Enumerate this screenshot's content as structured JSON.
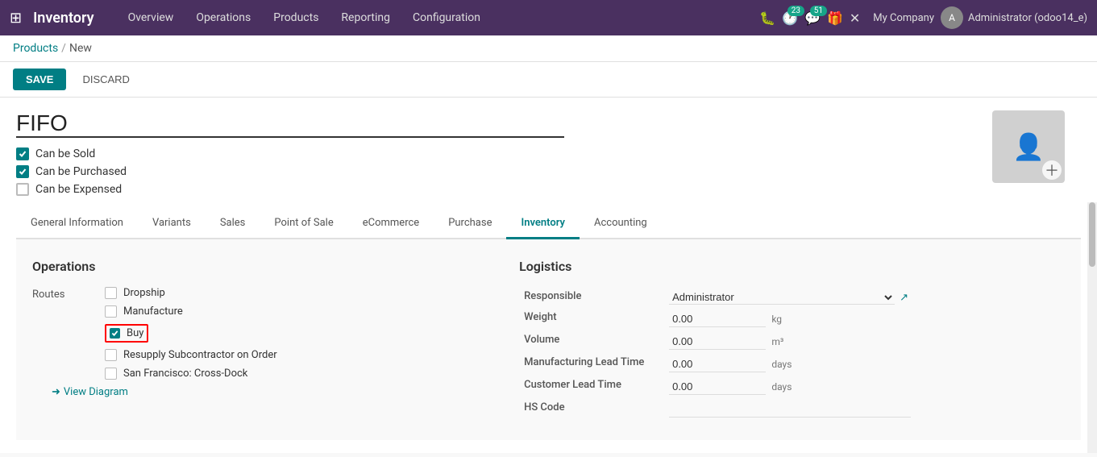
{
  "topbar": {
    "app_name": "Inventory",
    "nav_items": [
      "Overview",
      "Operations",
      "Products",
      "Reporting",
      "Configuration"
    ],
    "badge_23": "23",
    "badge_51": "51",
    "company": "My Company",
    "user": "Administrator (odoo14_e)"
  },
  "breadcrumb": {
    "link": "Products",
    "separator": "/",
    "current": "New"
  },
  "actions": {
    "save": "SAVE",
    "discard": "DISCARD"
  },
  "product": {
    "name": "FIFO",
    "can_be_sold": true,
    "can_be_purchased": true,
    "can_be_expensed": false
  },
  "tabs": [
    {
      "label": "General Information",
      "active": false
    },
    {
      "label": "Variants",
      "active": false
    },
    {
      "label": "Sales",
      "active": false
    },
    {
      "label": "Point of Sale",
      "active": false
    },
    {
      "label": "eCommerce",
      "active": false
    },
    {
      "label": "Purchase",
      "active": false
    },
    {
      "label": "Inventory",
      "active": true
    },
    {
      "label": "Accounting",
      "active": false
    }
  ],
  "operations": {
    "section_title": "Operations",
    "routes_label": "Routes",
    "routes": [
      {
        "label": "Dropship",
        "checked": false,
        "highlighted": false
      },
      {
        "label": "Manufacture",
        "checked": false,
        "highlighted": false
      },
      {
        "label": "Buy",
        "checked": true,
        "highlighted": true
      },
      {
        "label": "Resupply Subcontractor on Order",
        "checked": false,
        "highlighted": false
      },
      {
        "label": "San Francisco: Cross-Dock",
        "checked": false,
        "highlighted": false
      }
    ],
    "view_diagram": "View Diagram"
  },
  "logistics": {
    "section_title": "Logistics",
    "responsible_label": "Responsible",
    "responsible_value": "Administrator",
    "weight_label": "Weight",
    "weight_value": "0.00",
    "weight_unit": "kg",
    "volume_label": "Volume",
    "volume_value": "0.00",
    "volume_unit": "m³",
    "mfg_lead_label": "Manufacturing Lead Time",
    "mfg_lead_value": "0.00",
    "mfg_lead_unit": "days",
    "customer_lead_label": "Customer Lead Time",
    "customer_lead_value": "0.00",
    "customer_lead_unit": "days",
    "hs_code_label": "HS Code",
    "hs_code_value": ""
  }
}
